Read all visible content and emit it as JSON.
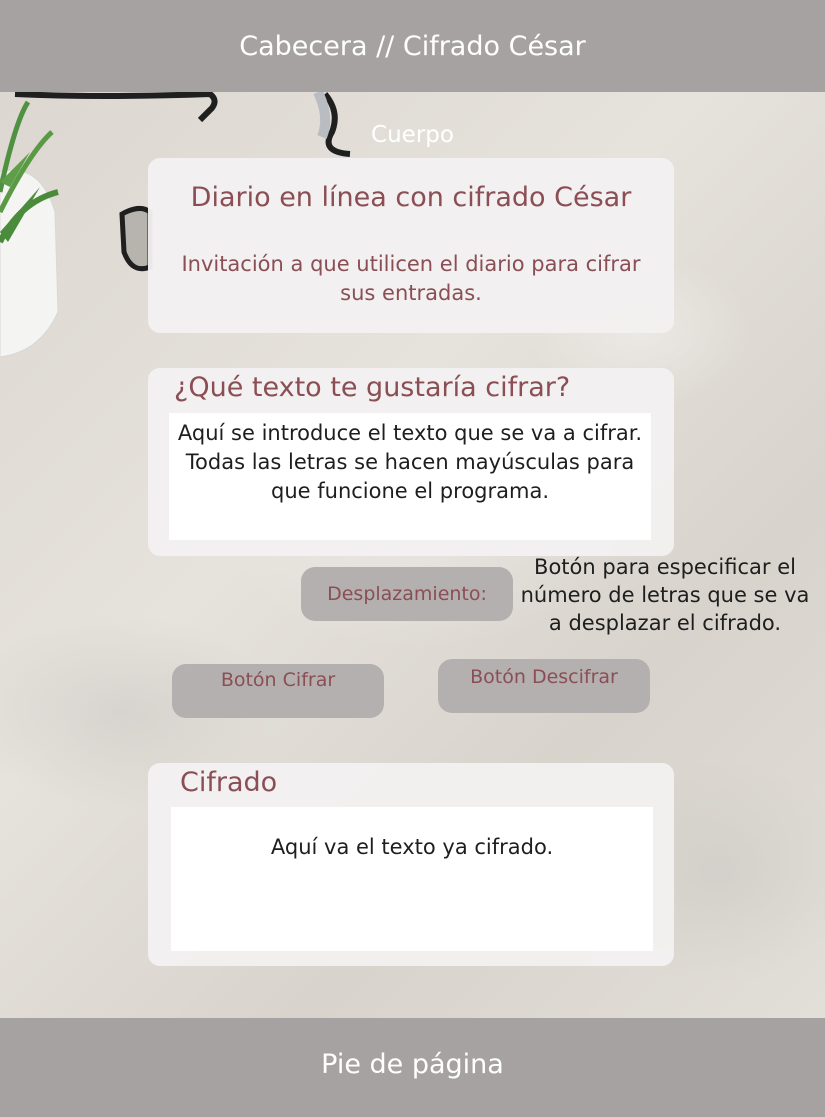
{
  "header": {
    "title": "Cabecera // Cifrado César"
  },
  "body": {
    "label": "Cuerpo"
  },
  "intro_card": {
    "title": "Diario en línea con cifrado César",
    "subtitle": "Invitación a que utilicen el diario para cifrar sus entradas."
  },
  "input_card": {
    "title": "¿Qué texto te gustaría cifrar?",
    "text": "Aquí se introduce el texto que se va a cifrar. Todas las letras se hacen mayúsculas para que funcione el programa."
  },
  "shift": {
    "label": "Desplazamiento:",
    "note": "Botón para especificar el número de letras que se va a desplazar el cifrado."
  },
  "buttons": {
    "encrypt": "Botón Cifrar",
    "decrypt": "Botón Descifrar"
  },
  "output_card": {
    "title": "Cifrado",
    "text": "Aquí va el texto ya cifrado."
  },
  "footer": {
    "text": "Pie de página"
  },
  "colors": {
    "bar": "#a6a2a2",
    "accent_text": "#8a4e54",
    "card": "#f2f0f0",
    "pill": "#b4b0b0"
  },
  "icons": [
    "plant-decoration",
    "glasses-decoration"
  ]
}
